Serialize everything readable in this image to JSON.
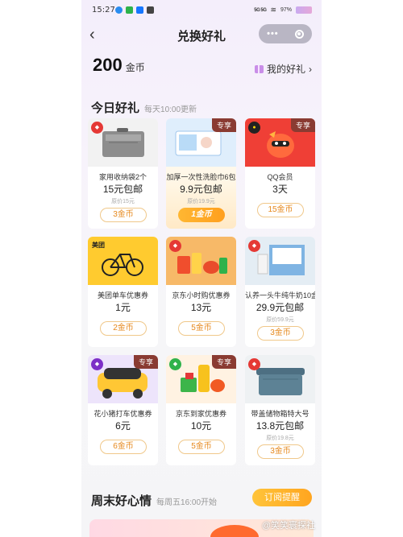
{
  "status_bar": {
    "time": "15:27",
    "network": "5G 5G",
    "battery": "97%"
  },
  "nav": {
    "title": "兑换好礼",
    "back_icon": "chevron-left-icon"
  },
  "coins": {
    "amount": "200",
    "unit": "金币",
    "my_gifts": "我的好礼",
    "chevron": "›"
  },
  "today": {
    "title": "今日好礼",
    "subtitle": "每天10:00更新",
    "items": [
      {
        "name": "家用收纳袋2个",
        "price": "15元包邮",
        "original": "原价15元",
        "button": "3金币",
        "badge": ""
      },
      {
        "name": "加厚一次性洗脸巾6包",
        "price": "9.9元包邮",
        "original": "原价19.9元",
        "button": "1金币",
        "badge": "专享"
      },
      {
        "name": "QQ会员",
        "price": "3天",
        "original": "",
        "button": "15金币",
        "badge": "专享"
      },
      {
        "name": "美团单车优惠券",
        "price": "1元",
        "original": "",
        "button": "2金币",
        "badge": "",
        "logo": "美团"
      },
      {
        "name": "京东小时购优惠券",
        "price": "13元",
        "original": "",
        "button": "5金币",
        "badge": ""
      },
      {
        "name": "认养一头牛纯牛奶10盒",
        "price": "29.9元包邮",
        "original": "原价59.9元",
        "button": "3金币",
        "badge": ""
      },
      {
        "name": "花小猪打车优惠券",
        "price": "6元",
        "original": "",
        "button": "6金币",
        "badge": "专享"
      },
      {
        "name": "京东到家优惠券",
        "price": "10元",
        "original": "",
        "button": "5金币",
        "badge": "专享"
      },
      {
        "name": "带盖储物箱特大号",
        "price": "13.8元包邮",
        "original": "原价19.8元",
        "button": "3金币",
        "badge": ""
      }
    ]
  },
  "weekend": {
    "title": "周末好心情",
    "subtitle": "每周五16:00开始",
    "subscribe": "订阅提醒"
  },
  "watermark": "@笑笑寰探社",
  "colors": {
    "accent": "#ffa51f",
    "button_border": "#f0c88a",
    "button_text": "#e6881c",
    "badge": "#8a3b32"
  }
}
